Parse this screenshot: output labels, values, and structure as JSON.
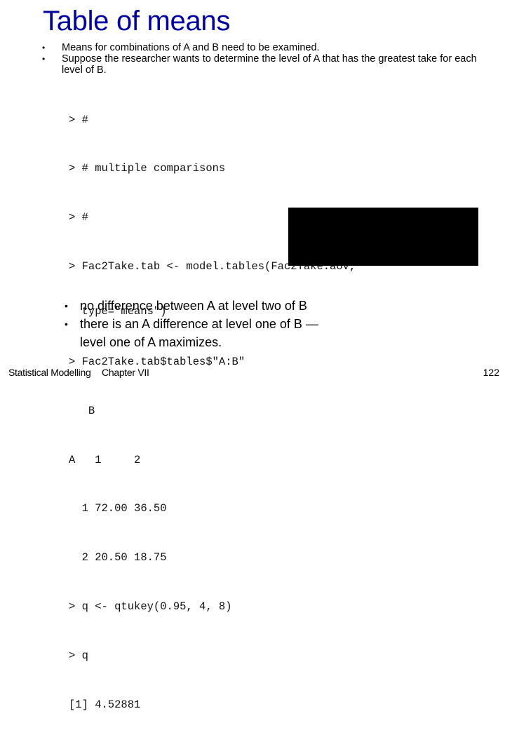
{
  "slide": {
    "title": "Table of means",
    "bullets": [
      {
        "marker": "•",
        "text": "Means for combinations of A and B need to be examined."
      },
      {
        "marker": "•",
        "text": "Suppose the researcher wants to determine the level of A that has the greatest take for each level of B."
      }
    ],
    "code_lines": [
      "> #",
      "> # multiple comparisons",
      "> #",
      "> Fac2Take.tab <- model.tables(Fac2Take.aov,",
      "  type=\"means\")",
      "> Fac2Take.tab$tables$\"A:B\"",
      "   B",
      "A   1     2",
      "  1 72.00 36.50",
      "  2 20.50 18.75",
      "> q <- qtukey(0.95, 4, 8)",
      "> q",
      "[1] 4.52881"
    ],
    "notes": [
      {
        "marker": "•",
        "text": "no difference between A at level two of B"
      },
      {
        "marker": "•",
        "text": "there is an A difference at level one of B —"
      },
      {
        "marker": "",
        "text": "level one of A maximizes."
      }
    ],
    "footer": {
      "course": "Statistical Modelling",
      "chapter": "Chapter VII",
      "page_number": "122"
    },
    "colors": {
      "title": "#00009e",
      "redaction_box": "#000000"
    }
  }
}
